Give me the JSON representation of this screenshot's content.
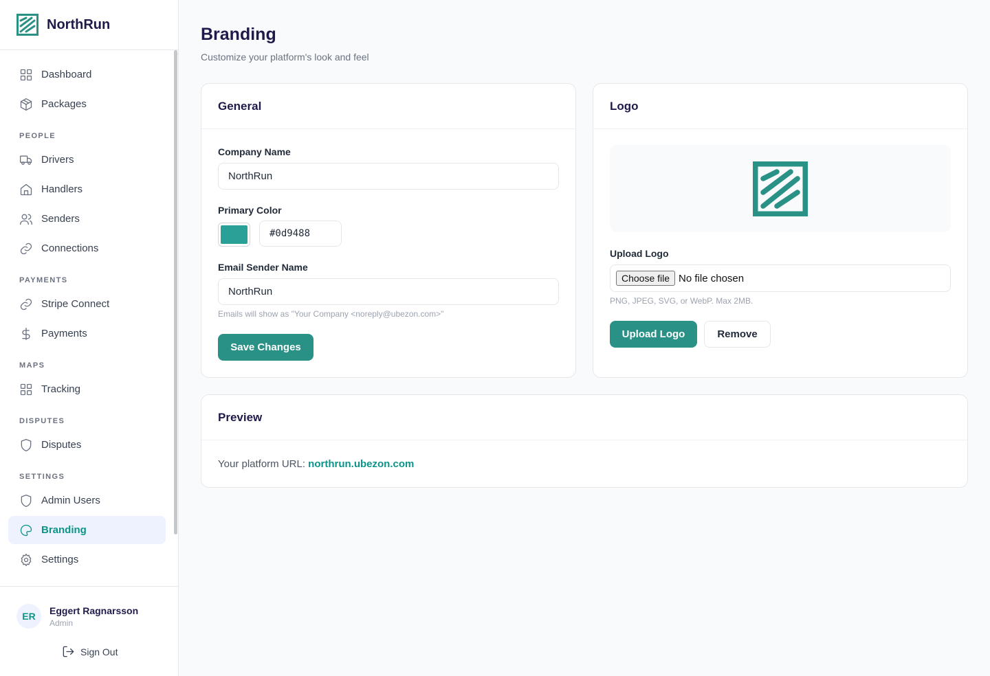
{
  "brand": {
    "name": "NorthRun",
    "logo_icon": "northrun-logo"
  },
  "sidebar": {
    "items": [
      {
        "label": "Dashboard",
        "icon": "grid-icon"
      },
      {
        "label": "Packages",
        "icon": "box-icon"
      }
    ],
    "sections": [
      {
        "title": "PEOPLE",
        "items": [
          {
            "label": "Drivers",
            "icon": "truck-icon"
          },
          {
            "label": "Handlers",
            "icon": "home-icon"
          },
          {
            "label": "Senders",
            "icon": "users-icon"
          },
          {
            "label": "Connections",
            "icon": "link-icon"
          }
        ]
      },
      {
        "title": "PAYMENTS",
        "items": [
          {
            "label": "Stripe Connect",
            "icon": "link-icon"
          },
          {
            "label": "Payments",
            "icon": "dollar-icon"
          }
        ]
      },
      {
        "title": "MAPS",
        "items": [
          {
            "label": "Tracking",
            "icon": "grid-icon"
          }
        ]
      },
      {
        "title": "DISPUTES",
        "items": [
          {
            "label": "Disputes",
            "icon": "shield-icon"
          }
        ]
      },
      {
        "title": "SETTINGS",
        "items": [
          {
            "label": "Admin Users",
            "icon": "shield-icon"
          },
          {
            "label": "Branding",
            "icon": "palette-icon",
            "active": true
          },
          {
            "label": "Settings",
            "icon": "gear-icon"
          }
        ]
      }
    ]
  },
  "user": {
    "initials": "ER",
    "name": "Eggert Ragnarsson",
    "role": "Admin",
    "signout_label": "Sign Out"
  },
  "page": {
    "title": "Branding",
    "subtitle": "Customize your platform's look and feel"
  },
  "general": {
    "title": "General",
    "company_name_label": "Company Name",
    "company_name_value": "NorthRun",
    "primary_color_label": "Primary Color",
    "primary_color_value": "#0d9488",
    "email_sender_label": "Email Sender Name",
    "email_sender_value": "NorthRun",
    "email_hint": "Emails will show as \"Your Company <noreply@ubezon.com>\"",
    "save_label": "Save Changes"
  },
  "logo": {
    "title": "Logo",
    "upload_label": "Upload Logo",
    "choose_file_label": "Choose file",
    "file_status": "No file chosen",
    "hint": "PNG, JPEG, SVG, or WebP. Max 2MB.",
    "upload_button": "Upload Logo",
    "remove_button": "Remove"
  },
  "preview": {
    "title": "Preview",
    "url_label": "Your platform URL: ",
    "url_value": "northrun.ubezon.com"
  },
  "colors": {
    "accent": "#0d9488",
    "active_bg": "#eef2ff",
    "text_dark": "#1e1b4b"
  }
}
